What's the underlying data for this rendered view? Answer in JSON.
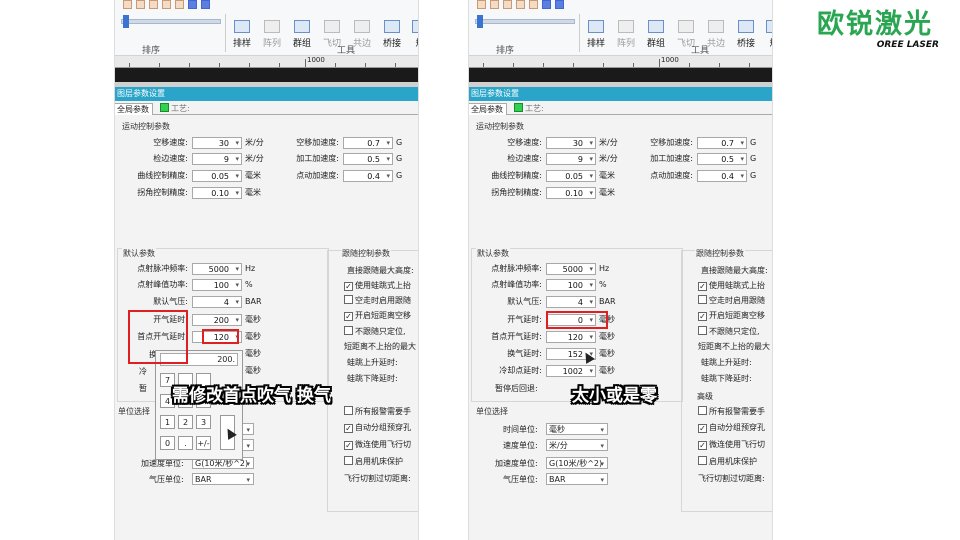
{
  "logo": {
    "name_cn": "欧锐激光",
    "name_en": "OREE LASER"
  },
  "ribbon": {
    "buttons": [
      "排样",
      "阵列",
      "群组",
      "飞切",
      "共边",
      "桥接",
      "规"
    ],
    "group_sort": "排序",
    "group_tools": "工具"
  },
  "ruler": {
    "ticks": [
      "1000"
    ]
  },
  "dialog": {
    "title": "图层参数设置",
    "tab_global": "全局参数",
    "tab_process": "工艺:"
  },
  "motion": {
    "title": "运动控制参数",
    "rows": [
      {
        "label": "空移速度:",
        "value": "30",
        "unit": "米/分"
      },
      {
        "label": "检边速度:",
        "value": "9",
        "unit": "米/分"
      },
      {
        "label": "曲线控制精度:",
        "value": "0.05",
        "unit": "毫米"
      },
      {
        "label": "拐角控制精度:",
        "value": "0.10",
        "unit": "毫米"
      }
    ],
    "accel": [
      {
        "label": "空移加速度:",
        "value": "0.7",
        "unit": "G"
      },
      {
        "label": "加工加速度:",
        "value": "0.5",
        "unit": "G"
      },
      {
        "label": "点动加速度:",
        "value": "0.4",
        "unit": "G"
      }
    ]
  },
  "defaults": {
    "title": "默认参数",
    "freq": {
      "label": "点射脉冲频率:",
      "value": "5000",
      "unit": "Hz"
    },
    "power": {
      "label": "点射峰值功率:",
      "value": "100",
      "unit": "%"
    },
    "pressure": {
      "label": "默认气压:",
      "value": "4",
      "unit": "BAR"
    },
    "open_delay": {
      "label": "开气延时:",
      "unit": "毫秒"
    },
    "first_open": {
      "label": "首点开气延时:",
      "unit": "毫秒"
    },
    "switch_gas": {
      "label": "换气延时:",
      "unit": "毫秒"
    },
    "cool": {
      "label": "冷却点延时:",
      "unit": "毫秒"
    },
    "pause_back": {
      "label": "暂停后回退:"
    },
    "left_values": {
      "open_delay": "200",
      "first_open": "120"
    },
    "right_values": {
      "open_delay": "0",
      "first_open": "120",
      "switch_gas": "152",
      "cool": "1002"
    },
    "left_partial": {
      "switch_gas": "换",
      "cool": "冷",
      "pause_back": "暂"
    }
  },
  "units": {
    "title": "单位选择",
    "time": {
      "label": "时间单位:",
      "value": "毫秒"
    },
    "speed": {
      "label": "速度单位:",
      "value": "米/分"
    },
    "accel": {
      "label": "加速度单位:",
      "value": "G(10米/秒^2)"
    },
    "pressure": {
      "label": "气压单位:",
      "value": "BAR"
    }
  },
  "follow": {
    "title": "跟随控制参数",
    "items": [
      {
        "text": "直接跟随最大高度:",
        "type": "label"
      },
      {
        "text": "使用蛙跳式上抬",
        "type": "check",
        "checked": true
      },
      {
        "text": "空走时启用跟随",
        "type": "check",
        "checked": false
      },
      {
        "text": "开启短距离空移",
        "type": "check",
        "checked": true
      },
      {
        "text": "不跟随只定位, ",
        "type": "check",
        "checked": false
      },
      {
        "text": "短距离不上抬的最大",
        "type": "label"
      },
      {
        "text": "蛙跳上升延时:",
        "type": "label"
      },
      {
        "text": "蛙跳下降延时:",
        "type": "label"
      }
    ],
    "advanced_title": "高级",
    "advanced": [
      {
        "text": "所有报警需要手",
        "checked": false
      },
      {
        "text": "自动分组预穿孔",
        "checked": true
      },
      {
        "text": "微连使用飞行切",
        "checked": true
      },
      {
        "text": "启用机床保护",
        "checked": false
      }
    ],
    "flight": "飞行切割过切距离:"
  },
  "keypad": {
    "display": "200.",
    "keys": [
      "7",
      "4",
      "1",
      "2",
      "3",
      "0",
      ".",
      "+/-"
    ]
  },
  "captions": {
    "left": "需修改首点吹气 换气",
    "right": "太小或是零"
  }
}
